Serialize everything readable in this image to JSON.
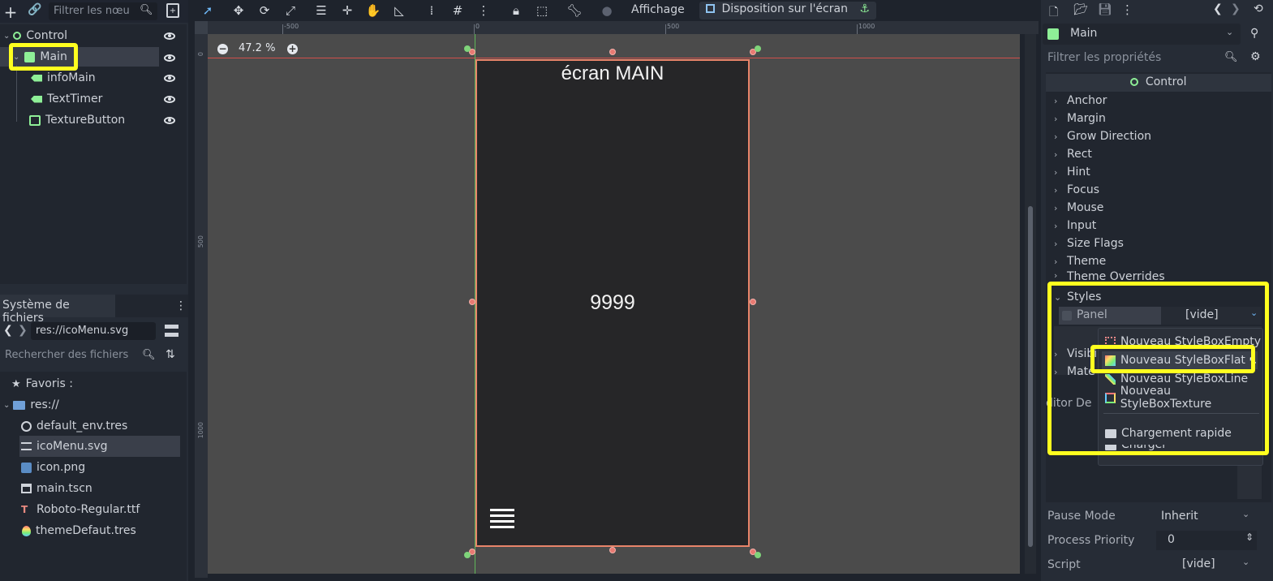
{
  "scene_dock": {
    "filter_placeholder": "Filtrer les nœu",
    "nodes": [
      {
        "label": "Control",
        "icon": "control-node-icon"
      },
      {
        "label": "Main",
        "icon": "panel-node-icon"
      },
      {
        "label": "infoMain",
        "icon": "label-node-icon"
      },
      {
        "label": "TextTimer",
        "icon": "label-node-icon"
      },
      {
        "label": "TextureButton",
        "icon": "texture-button-icon"
      }
    ]
  },
  "filesystem": {
    "tab_label": "Système de fichiers",
    "path": "res://icoMenu.svg",
    "search_placeholder": "Rechercher des fichiers",
    "favorites": "Favoris :",
    "root": "res://",
    "files": [
      {
        "name": "default_env.tres",
        "icon": "environment-icon"
      },
      {
        "name": "icoMenu.svg",
        "icon": "svg-file-icon"
      },
      {
        "name": "icon.png",
        "icon": "image-file-icon"
      },
      {
        "name": "main.tscn",
        "icon": "scene-file-icon"
      },
      {
        "name": "Roboto-Regular.ttf",
        "icon": "font-file-icon"
      },
      {
        "name": "themeDefaut.tres",
        "icon": "theme-file-icon"
      }
    ]
  },
  "toolbar": {
    "view_menu": "Affichage",
    "layout_menu": "Disposition sur l'écran"
  },
  "rulers": {
    "h_ticks": [
      "-500",
      "0",
      "500",
      "1000"
    ],
    "v_ticks": [
      "0",
      "500",
      "1000"
    ]
  },
  "viewport": {
    "zoom": "47.2 %",
    "title_text": "écran MAIN",
    "counter_text": "9999"
  },
  "inspector": {
    "node_name": "Main",
    "filter_placeholder": "Filtrer les propriétés",
    "class_header": "Control",
    "sections": [
      "Anchor",
      "Margin",
      "Grow Direction",
      "Rect",
      "Hint",
      "Focus",
      "Mouse",
      "Input",
      "Size Flags",
      "Theme",
      "Theme Overrides"
    ],
    "styles_label": "Styles",
    "panel_label": "Panel",
    "panel_value": "[vide]",
    "partial_visible": "Visibi",
    "partial_material": "Mate",
    "partial_editor": "ditor De",
    "pause_mode_label": "Pause Mode",
    "pause_mode_value": "Inherit",
    "process_priority_label": "Process Priority",
    "process_priority_value": "0",
    "script_label": "Script",
    "script_value": "[vide]"
  },
  "dropdown": {
    "items": [
      {
        "label": "Nouveau StyleBoxEmpty",
        "icon": "stylebox-empty-icon"
      },
      {
        "label": "Nouveau StyleBoxFlat",
        "icon": "stylebox-flat-icon"
      },
      {
        "label": "Nouveau StyleBoxLine",
        "icon": "stylebox-line-icon"
      },
      {
        "label": "Nouveau StyleBoxTexture",
        "icon": "stylebox-texture-icon"
      }
    ],
    "quick_load": "Chargement rapide",
    "load": "Charger"
  },
  "colors": {
    "highlight": "#ffff1f",
    "accent": "#70bafa",
    "node_green": "#8eef97",
    "selection_outline": "#e8846a"
  }
}
